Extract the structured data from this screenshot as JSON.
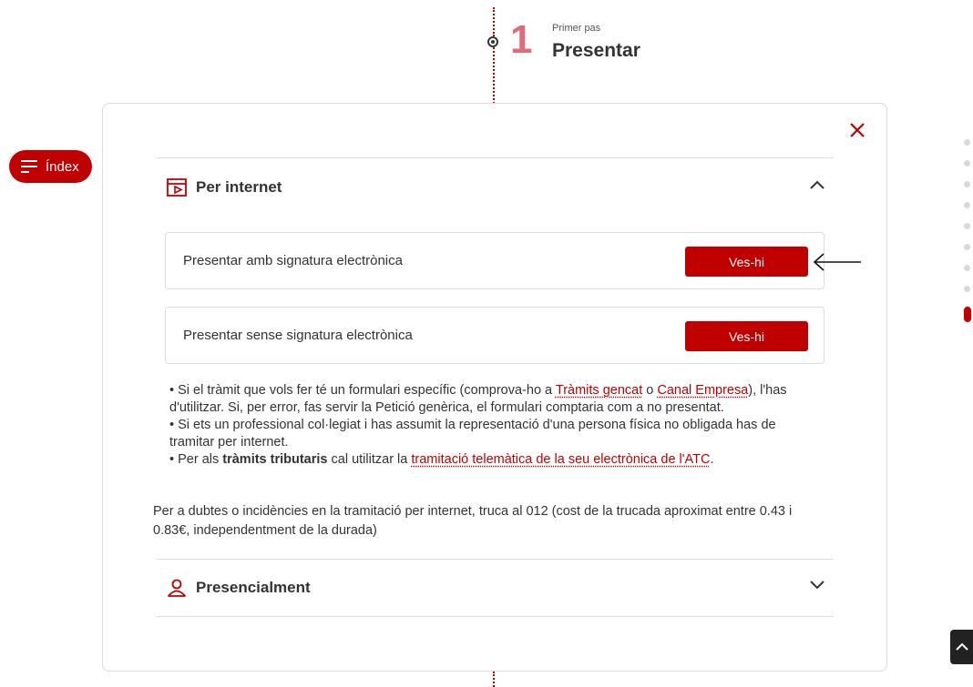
{
  "step": {
    "number": "1",
    "subtitle": "Primer pas",
    "title": "Presentar"
  },
  "index_button": {
    "label": "Índex"
  },
  "accordion": {
    "internet": {
      "label": "Per internet",
      "options": [
        {
          "label": "Presentar amb signatura electrònica",
          "button": "Ves-hi"
        },
        {
          "label": "Presentar sense signatura electrònica",
          "button": "Ves-hi"
        }
      ],
      "notes": {
        "n1_a": "• Si el tràmit que vols fer té un formulari específic (comprova-ho a ",
        "n1_link1": "Tràmits gencat",
        "n1_b": " o ",
        "n1_link2": "Canal Empresa",
        "n1_c": "), l'has d'utilitzar. Si, per error, fas servir la Petició genèrica, el formulari comptaria com a no presentat.",
        "n2": "• Si ets un professional col·legiat i has assumit la representació d'una persona física no obligada has de tramitar per internet.",
        "n3_a": "• Per als ",
        "n3_bold": "tràmits tributaris",
        "n3_b": " cal utilitzar la ",
        "n3_link": "tramitació telemàtica de la seu electrònica de l'ATC",
        "n3_c": "."
      },
      "help": "Per a dubtes o incidències en la tramitació per internet, truca al 012 (cost de la trucada aproximat entre 0.43 i 0.83€, independentment de la durada)"
    },
    "presencial": {
      "label": "Presencialment"
    }
  },
  "progress": {
    "total": 9,
    "active": 9
  },
  "colors": {
    "accent": "#c00000",
    "step_number": "#e06c75"
  },
  "icons": [
    "menu-icon",
    "close-icon",
    "internet-icon",
    "chevron-up-icon",
    "chevron-down-icon",
    "person-icon",
    "arrow-left-icon",
    "arrow-up-icon"
  ]
}
